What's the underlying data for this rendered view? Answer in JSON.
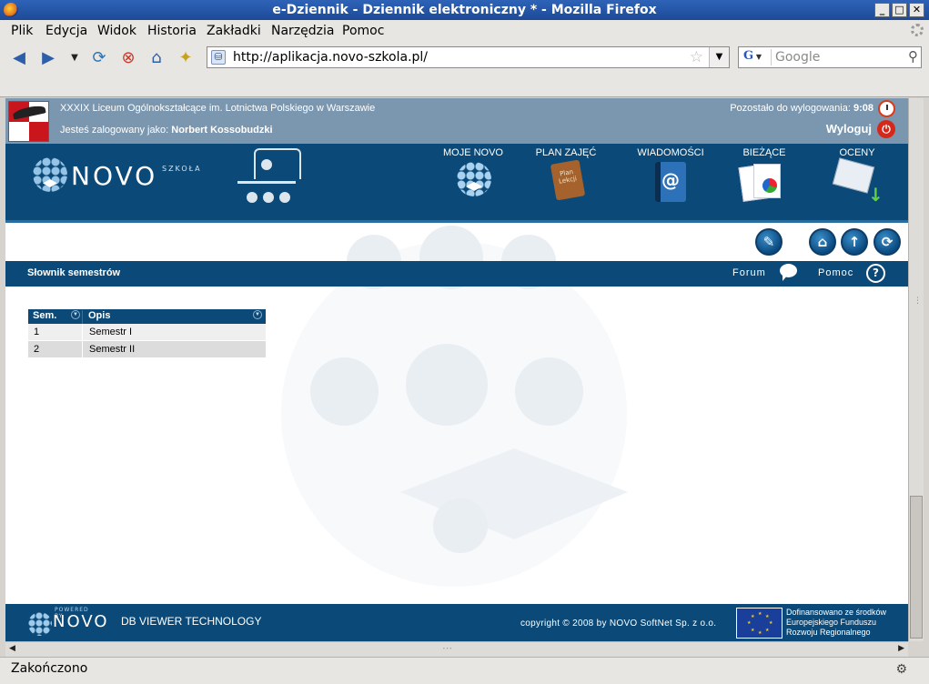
{
  "window": {
    "title": "e-Dziennik - Dziennik elektroniczny * - Mozilla Firefox",
    "minimize": "_",
    "maximize": "□",
    "close": "✕"
  },
  "menu": {
    "items": [
      {
        "label": "Plik"
      },
      {
        "label": "Edycja"
      },
      {
        "label": "Widok"
      },
      {
        "label": "Historia"
      },
      {
        "label": "Zakładki"
      },
      {
        "label": "Narzędzia"
      },
      {
        "label": "Pomoc"
      }
    ]
  },
  "toolbar": {
    "url": "http://aplikacja.novo-szkola.pl/",
    "search_engine": "G",
    "search_placeholder": "Google"
  },
  "header": {
    "school": "XXXIX Liceum Ogólnokształcące im. Lotnictwa Polskiego w Warszawie",
    "logged_prefix": "Jesteś zalogowany jako:",
    "user": "Norbert Kossobudzki",
    "timer_prefix": "Pozostało do wylogowania:",
    "timer_value": "9:08",
    "logout": "Wyloguj"
  },
  "brand": {
    "name": "NOVO",
    "sub": "SZKOŁA"
  },
  "nav": [
    {
      "label": "MOJE NOVO",
      "icon": "globe-icon"
    },
    {
      "label": "PLAN ZAJĘĆ",
      "icon": "planner-icon",
      "icon_text": "Plan Lekcji"
    },
    {
      "label": "WIADOMOŚCI",
      "icon": "mail-book-icon"
    },
    {
      "label": "BIEŻĄCE",
      "icon": "reports-icon"
    },
    {
      "label": "OCENY",
      "icon": "grades-icon"
    }
  ],
  "section": {
    "title": "Słownik semestrów",
    "forum": "Forum",
    "help": "Pomoc"
  },
  "table": {
    "columns": [
      "Sem.",
      "Opis"
    ],
    "rows": [
      {
        "sem": "1",
        "opis": "Semestr I"
      },
      {
        "sem": "2",
        "opis": "Semestr II"
      }
    ]
  },
  "footer": {
    "powered": "POWERED BY",
    "novo": "NOVO",
    "technology": "DB VIEWER TECHNOLOGY",
    "copyright": "copyright © 2008 by NOVO SoftNet Sp. z o.o.",
    "eu_line1": "Dofinansowano ze środków",
    "eu_line2": "Europejskiego Funduszu",
    "eu_line3": "Rozwoju Regionalnego"
  },
  "status": {
    "text": "Zakończono"
  },
  "colors": {
    "brand_blue": "#0b4a78",
    "header_strip": "#7b97b0",
    "logout_red": "#d5281b"
  }
}
